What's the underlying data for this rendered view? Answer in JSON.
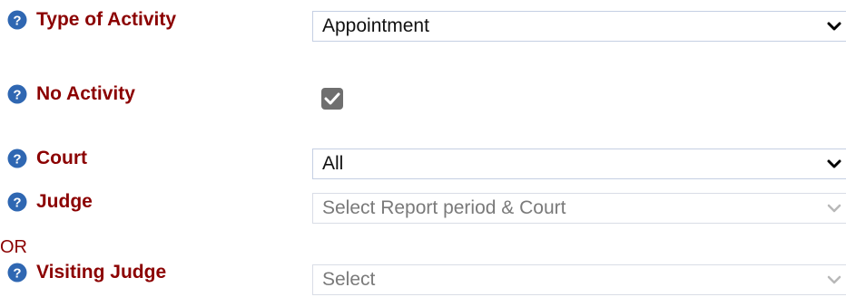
{
  "fields": [
    {
      "label": "Type of Activity",
      "control": "select",
      "value": "Appointment"
    },
    {
      "label": "No Activity",
      "control": "checkbox",
      "checked": true
    },
    {
      "label": "Court",
      "control": "select",
      "value": "All"
    },
    {
      "label": "Judge",
      "control": "select",
      "value": "Select Report period & Court",
      "disabled": true
    },
    {
      "label": "Visiting Judge",
      "control": "select",
      "value": "Select",
      "disabled": true
    }
  ],
  "separator": "OR",
  "icons": {
    "help": "question-circle-icon",
    "dropdown": "chevron-down-icon",
    "check": "checkmark-icon"
  },
  "colors": {
    "label": "#8b0000",
    "help_icon": "#2f67b2",
    "checkbox": "#6f6f6f",
    "select_border": "#c5cfe3",
    "disabled_text": "#7a7a7a"
  }
}
